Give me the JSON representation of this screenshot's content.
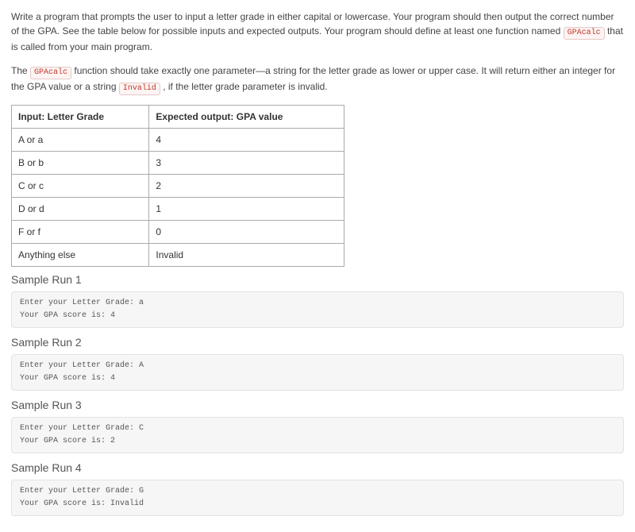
{
  "para1": {
    "seg1": "Write a program that prompts the user to input a letter grade in either capital or lowercase. Your program should then output the correct number of the GPA. See the table below for possible inputs and expected outputs. Your program should define at least one function named ",
    "chip1": "GPAcalc",
    "seg2": " that is called from your main program."
  },
  "para2": {
    "seg1": "The ",
    "chip1": "GPAcalc",
    "seg2": " function should take exactly one parameter—a string for the letter grade as lower or upper case. It will return either an integer for the GPA value or a string ",
    "chip2": "Invalid",
    "seg3": " , if the letter grade parameter is invalid."
  },
  "table": {
    "header_input": "Input: Letter Grade",
    "header_output": "Expected output: GPA value",
    "rows": [
      {
        "input": "A or a",
        "output": "4"
      },
      {
        "input": "B or b",
        "output": "3"
      },
      {
        "input": "C or c",
        "output": "2"
      },
      {
        "input": "D or d",
        "output": "1"
      },
      {
        "input": "F or f",
        "output": "0"
      },
      {
        "input": "Anything else",
        "output": "Invalid"
      }
    ]
  },
  "samples": [
    {
      "title": "Sample Run 1",
      "text": "Enter your Letter Grade: a\nYour GPA score is: 4"
    },
    {
      "title": "Sample Run 2",
      "text": "Enter your Letter Grade: A\nYour GPA score is: 4"
    },
    {
      "title": "Sample Run 3",
      "text": "Enter your Letter Grade: C\nYour GPA score is: 2"
    },
    {
      "title": "Sample Run 4",
      "text": "Enter your Letter Grade: G\nYour GPA score is: Invalid"
    }
  ]
}
